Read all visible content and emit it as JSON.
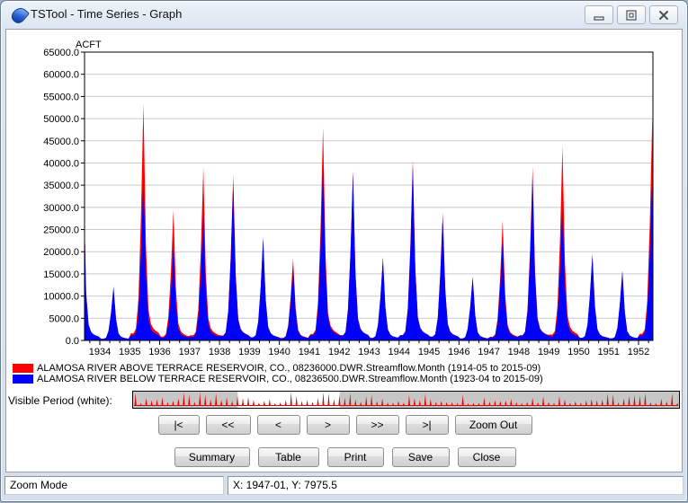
{
  "window": {
    "title": "TSTool - Time Series - Graph",
    "icon": "tstool-water-drop-icon",
    "controls": {
      "minimize": "minimize-icon",
      "maximize": "maximize-icon",
      "close": "close-icon"
    }
  },
  "chart_data": {
    "type": "area",
    "title": "",
    "ylabel": "ACFT",
    "xlabel": "",
    "ylim": [
      0,
      65000
    ],
    "xlim": [
      1933.49,
      1952.48
    ],
    "grid": "horizontal-only",
    "legend_position": "bottom-left",
    "y_tick_labels": [
      "0.0",
      "5000.0",
      "10000.0",
      "15000.0",
      "20000.0",
      "25000.0",
      "30000.0",
      "35000.0",
      "40000.0",
      "45000.0",
      "50000.0",
      "55000.0",
      "60000.0",
      "65000.0"
    ],
    "x_tick_labels": [
      "1934",
      "1935",
      "1936",
      "1937",
      "1938",
      "1939",
      "1940",
      "1941",
      "1942",
      "1943",
      "1944",
      "1945",
      "1946",
      "1947",
      "1948",
      "1949",
      "1950",
      "1951",
      "1952"
    ],
    "years": [
      1933,
      1934,
      1935,
      1936,
      1937,
      1938,
      1939,
      1940,
      1941,
      1942,
      1943,
      1944,
      1945,
      1946,
      1947,
      1948,
      1949,
      1950,
      1951,
      1952
    ],
    "monthly_profile": [
      0.03,
      0.03,
      0.05,
      0.18,
      0.52,
      1.0,
      0.4,
      0.13,
      0.07,
      0.05,
      0.04,
      0.033
    ],
    "series": [
      {
        "name": "ALAMOSA RIVER ABOVE TERRACE RESERVOIR, CO., 08236000.DWR.Streamflow.Month (1914-05 to 2015-09)",
        "color": "#ff0000",
        "annual_peaks": [
          27000,
          11800,
          53400,
          29300,
          38900,
          37300,
          22800,
          18500,
          48000,
          38200,
          18300,
          40700,
          28800,
          14000,
          27100,
          39100,
          43800,
          19000,
          15300,
          50200
        ]
      },
      {
        "name": "ALAMOSA RIVER BELOW TERRACE RESERVOIR, CO., 08236500.DWR.Streamflow.Month (1923-04 to 2015-09)",
        "color": "#0000ff",
        "annual_peaks": [
          27500,
          12200,
          37000,
          20800,
          28400,
          35400,
          23300,
          16300,
          39500,
          37800,
          18800,
          39300,
          28000,
          14400,
          22500,
          36700,
          30700,
          19500,
          15800,
          37100
        ]
      }
    ]
  },
  "visible_period": {
    "label": "Visible Period (white):",
    "full_start": 1914.0,
    "full_end": 2015.75,
    "visible_start": 1933.5,
    "visible_end": 1952.5,
    "strip_series_color": "#e00000",
    "strip_background": "#c6c6c6",
    "window_color": "#ffffff"
  },
  "nav_buttons": [
    "|<",
    "<<",
    "<",
    ">",
    ">>",
    ">|",
    "Zoom Out"
  ],
  "action_buttons": [
    "Summary",
    "Table",
    "Print",
    "Save",
    "Close"
  ],
  "status_bar": {
    "mode": "Zoom Mode",
    "coordinates": "X:  1947-01,  Y:  7975.5"
  },
  "colors": {
    "grid": "#c9c9c9",
    "plot_border": "#000000"
  }
}
